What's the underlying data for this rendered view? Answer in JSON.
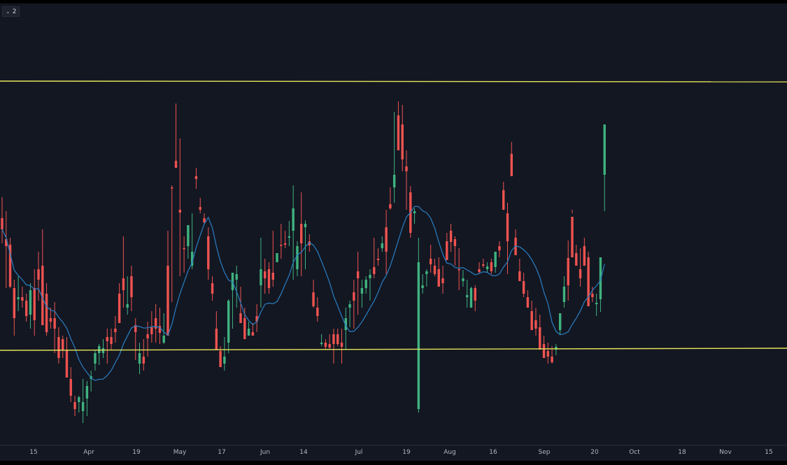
{
  "panel": {
    "collapse_count": "2",
    "collapse_icon": "chevron-down-icon"
  },
  "colors": {
    "background": "#131722",
    "up": "#26a69a",
    "up_body": "#3fb37f",
    "down": "#ef5350",
    "ma": "#2a7fc4",
    "hline": "#e6e65a",
    "axis_text": "#b2b5be"
  },
  "chart_data": {
    "type": "candlestick",
    "x_ticks": [
      "15",
      "Apr",
      "19",
      "May",
      "17",
      "Jun",
      "14",
      "Jul",
      "19",
      "Aug",
      "16",
      "Sep",
      "20",
      "Oct",
      "18",
      "Nov",
      "15"
    ],
    "horizontal_lines": [
      {
        "y_start": 116,
        "y_end": 117
      },
      {
        "y_start": 501,
        "y_end": 498
      }
    ],
    "price_scale": "none",
    "ma_period": 10,
    "candles": [
      [
        312,
        282,
        348,
        328
      ],
      [
        342,
        302,
        412,
        352
      ],
      [
        350,
        340,
        412,
        410
      ],
      [
        412,
        400,
        480,
        455
      ],
      [
        428,
        395,
        445,
        425
      ],
      [
        425,
        410,
        440,
        430
      ],
      [
        430,
        420,
        460,
        452
      ],
      [
        450,
        405,
        470,
        415
      ],
      [
        412,
        385,
        480,
        458
      ],
      [
        385,
        360,
        430,
        400
      ],
      [
        380,
        328,
        460,
        465
      ],
      [
        420,
        405,
        480,
        475
      ],
      [
        455,
        440,
        470,
        460
      ],
      [
        455,
        432,
        505,
        470
      ],
      [
        482,
        468,
        520,
        512
      ],
      [
        485,
        480,
        512,
        500
      ],
      [
        500,
        482,
        530,
        540
      ],
      [
        542,
        525,
        575,
        566
      ],
      [
        575,
        566,
        595,
        585
      ],
      [
        575,
        566,
        590,
        568
      ],
      [
        588,
        542,
        605,
        575
      ],
      [
        570,
        545,
        595,
        552
      ],
      [
        542,
        530,
        560,
        538
      ],
      [
        520,
        500,
        530,
        505
      ],
      [
        505,
        492,
        522,
        495
      ],
      [
        505,
        485,
        512,
        498
      ],
      [
        482,
        470,
        520,
        488
      ],
      [
        482,
        470,
        500,
        492
      ],
      [
        470,
        452,
        490,
        475
      ],
      [
        420,
        405,
        455,
        462
      ],
      [
        398,
        338,
        440,
        415
      ],
      [
        440,
        395,
        450,
        435
      ],
      [
        395,
        380,
        445,
        425
      ],
      [
        465,
        455,
        515,
        475
      ],
      [
        520,
        490,
        535,
        505
      ],
      [
        510,
        485,
        530,
        520
      ],
      [
        478,
        460,
        510,
        484
      ],
      [
        468,
        445,
        490,
        478
      ],
      [
        455,
        435,
        490,
        470
      ],
      [
        466,
        440,
        492,
        476
      ],
      [
        490,
        448,
        492,
        480
      ],
      [
        380,
        330,
        420,
        480
      ],
      [
        268,
        265,
        432,
        268
      ],
      [
        230,
        148,
        240,
        240
      ],
      [
        300,
        198,
        395,
        304
      ],
      [
        355,
        338,
        390,
        355
      ],
      [
        352,
        335,
        370,
        322
      ],
      [
        380,
        305,
        385,
        360
      ],
      [
        252,
        240,
        270,
        256
      ],
      [
        296,
        283,
        305,
        300
      ],
      [
        312,
        305,
        320,
        318
      ],
      [
        338,
        325,
        400,
        385
      ],
      [
        405,
        395,
        430,
        420
      ],
      [
        470,
        445,
        480,
        500
      ],
      [
        502,
        495,
        525,
        525
      ],
      [
        520,
        482,
        530,
        510
      ],
      [
        490,
        428,
        505,
        430
      ],
      [
        415,
        405,
        470,
        390
      ],
      [
        400,
        380,
        440,
        392
      ],
      [
        448,
        410,
        460,
        462
      ],
      [
        455,
        440,
        480,
        485
      ],
      [
        480,
        460,
        480,
        470
      ],
      [
        475,
        462,
        480,
        480
      ],
      [
        452,
        435,
        475,
        460
      ],
      [
        408,
        340,
        440,
        385
      ],
      [
        388,
        370,
        420,
        398
      ],
      [
        385,
        375,
        420,
        412
      ],
      [
        390,
        330,
        410,
        400
      ],
      [
        375,
        380,
        380,
        362
      ],
      [
        350,
        320,
        370,
        350
      ],
      [
        348,
        330,
        355,
        350
      ],
      [
        340,
        316,
        352,
        338
      ],
      [
        330,
        265,
        400,
        298
      ],
      [
        385,
        345,
        395,
        352
      ],
      [
        320,
        275,
        395,
        348
      ],
      [
        325,
        315,
        385,
        320
      ],
      [
        345,
        335,
        360,
        351
      ],
      [
        418,
        400,
        440,
        438
      ],
      [
        440,
        425,
        460,
        452
      ],
      [
        492,
        478,
        495,
        490
      ],
      [
        490,
        485,
        500,
        496
      ],
      [
        492,
        478,
        500,
        497
      ],
      [
        478,
        470,
        520,
        492
      ],
      [
        478,
        470,
        495,
        492
      ],
      [
        490,
        470,
        520,
        496
      ],
      [
        472,
        440,
        500,
        455
      ],
      [
        440,
        430,
        468,
        435
      ],
      [
        418,
        400,
        470,
        430
      ],
      [
        388,
        360,
        450,
        398
      ],
      [
        420,
        400,
        440,
        412
      ],
      [
        412,
        395,
        420,
        400
      ],
      [
        398,
        385,
        430,
        393
      ],
      [
        382,
        340,
        398,
        392
      ],
      [
        370,
        355,
        380,
        372
      ],
      [
        355,
        338,
        360,
        348
      ],
      [
        325,
        300,
        392,
        360
      ],
      [
        292,
        268,
        300,
        298
      ],
      [
        268,
        160,
        290,
        250
      ],
      [
        165,
        145,
        183,
        215
      ],
      [
        178,
        150,
        245,
        228
      ],
      [
        238,
        215,
        300,
        245
      ],
      [
        275,
        266,
        340,
        333
      ],
      [
        305,
        298,
        320,
        302
      ],
      [
        585,
        340,
        590,
        375
      ],
      [
        412,
        392,
        420,
        408
      ],
      [
        392,
        385,
        410,
        388
      ],
      [
        370,
        350,
        390,
        378
      ],
      [
        380,
        370,
        395,
        392
      ],
      [
        385,
        368,
        398,
        410
      ],
      [
        398,
        380,
        420,
        405
      ],
      [
        345,
        333,
        350,
        372
      ],
      [
        330,
        320,
        360,
        346
      ],
      [
        342,
        338,
        380,
        352
      ],
      [
        385,
        355,
        415,
        385
      ],
      [
        402,
        386,
        410,
        398
      ],
      [
        425,
        400,
        440,
        422
      ],
      [
        440,
        410,
        440,
        412
      ],
      [
        412,
        408,
        445,
        430
      ],
      [
        385,
        375,
        392,
        389
      ],
      [
        378,
        370,
        383,
        380
      ],
      [
        385,
        375,
        390,
        381
      ],
      [
        375,
        370,
        392,
        388
      ],
      [
        382,
        360,
        390,
        360
      ],
      [
        352,
        345,
        368,
        358
      ],
      [
        272,
        260,
        298,
        300
      ],
      [
        305,
        290,
        392,
        345
      ],
      [
        220,
        203,
        250,
        252
      ],
      [
        340,
        328,
        355,
        365
      ],
      [
        388,
        370,
        392,
        402
      ],
      [
        402,
        390,
        425,
        420
      ],
      [
        425,
        415,
        435,
        440
      ],
      [
        445,
        430,
        465,
        472
      ],
      [
        458,
        440,
        480,
        470
      ],
      [
        468,
        450,
        482,
        500
      ],
      [
        492,
        480,
        500,
        512
      ],
      [
        502,
        490,
        520,
        510
      ],
      [
        510,
        495,
        520,
        518
      ],
      [
        500,
        492,
        508,
        496
      ],
      [
        472,
        448,
        478,
        448
      ],
      [
        432,
        395,
        440,
        410
      ],
      [
        369,
        344,
        430,
        408
      ],
      [
        310,
        305,
        300,
        368
      ],
      [
        362,
        350,
        372,
        380
      ],
      [
        385,
        355,
        410,
        398
      ],
      [
        352,
        340,
        380,
        380
      ],
      [
        368,
        360,
        425,
        438
      ],
      [
        420,
        410,
        432,
        425
      ],
      [
        435,
        420,
        452,
        433
      ],
      [
        428,
        388,
        446,
        368
      ],
      [
        250,
        178,
        302,
        178
      ]
    ]
  }
}
